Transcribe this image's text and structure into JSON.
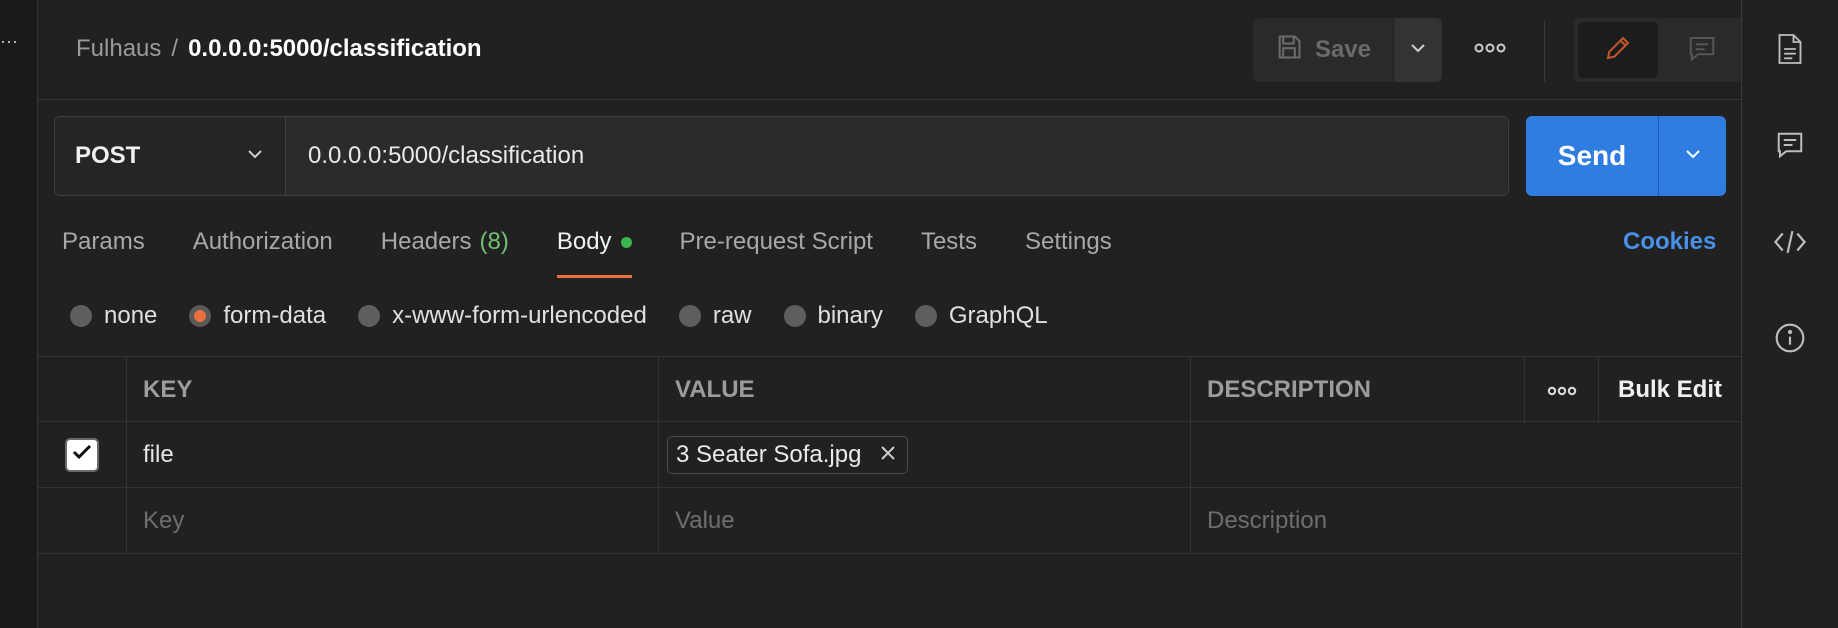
{
  "breadcrumb": {
    "parent": "Fulhaus",
    "separator": "/",
    "current": "0.0.0.0:5000/classification"
  },
  "toolbar": {
    "save_label": "Save"
  },
  "request": {
    "method": "POST",
    "url": "0.0.0.0:5000/classification",
    "send_label": "Send"
  },
  "tabs": [
    {
      "label": "Params"
    },
    {
      "label": "Authorization"
    },
    {
      "label": "Headers",
      "count": "(8)"
    },
    {
      "label": "Body",
      "active": true
    },
    {
      "label": "Pre-request Script"
    },
    {
      "label": "Tests"
    },
    {
      "label": "Settings"
    }
  ],
  "cookies_label": "Cookies",
  "body_types": [
    "none",
    "form-data",
    "x-www-form-urlencoded",
    "raw",
    "binary",
    "GraphQL"
  ],
  "body_type_selected": "form-data",
  "table": {
    "headers": {
      "key": "KEY",
      "value": "VALUE",
      "description": "DESCRIPTION",
      "bulk_edit": "Bulk Edit"
    },
    "rows": [
      {
        "checked": true,
        "key": "file",
        "value": "3 Seater Sofa.jpg",
        "description": ""
      }
    ],
    "placeholders": {
      "key": "Key",
      "value": "Value",
      "description": "Description"
    }
  },
  "colors": {
    "accent_orange": "#e8703a",
    "send_blue": "#2f7de1",
    "body_dot_green": "#3cb650",
    "headers_count_green": "#6cc070",
    "cookies_blue": "#4a90e8"
  }
}
